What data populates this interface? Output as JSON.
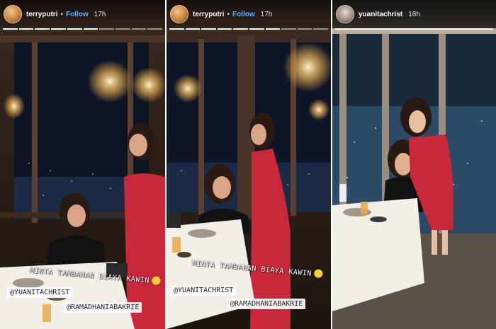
{
  "stories": [
    {
      "username": "terryputri",
      "follow_label": "Follow",
      "time": "17h",
      "caption": "MINTA TAMBAHAN BIAYA KAWIN",
      "mentions": [
        "@YUANITACHRIST",
        "@RAMADHANIABAKRIE"
      ]
    },
    {
      "username": "terryputri",
      "follow_label": "Follow",
      "time": "17h",
      "caption": "MINTA TAMBAHAN BIAYA KAWIN",
      "mentions": [
        "@YUANITACHRIST",
        "@RAMADHANIABAKRIE"
      ]
    },
    {
      "username": "yuanitachrist",
      "time": "18h"
    }
  ],
  "colors": {
    "follow": "#5fb0ff",
    "emoji": "#ffcc33",
    "dress": "#c8283a"
  }
}
